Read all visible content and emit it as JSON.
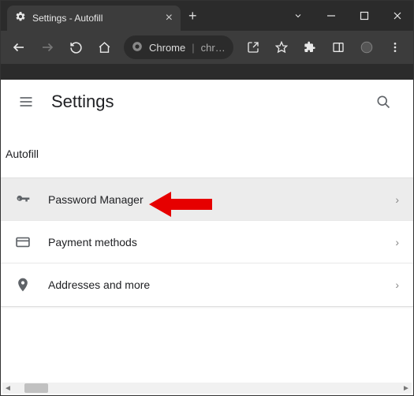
{
  "window": {
    "tab_title": "Settings - Autofill",
    "omnibox_label": "Chrome",
    "omnibox_url": "chrome://s…"
  },
  "header": {
    "title": "Settings"
  },
  "section": {
    "label": "Autofill",
    "items": [
      {
        "label": "Password Manager"
      },
      {
        "label": "Payment methods"
      },
      {
        "label": "Addresses and more"
      }
    ]
  }
}
